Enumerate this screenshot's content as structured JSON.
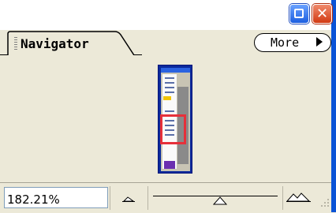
{
  "window": {
    "buttons": {
      "minimize": "minimize-icon",
      "close": "close-icon"
    }
  },
  "tab": {
    "label": "Navigator"
  },
  "more_button": {
    "label": "More"
  },
  "zoom": {
    "value": "182.21%"
  },
  "colors": {
    "panel_bg": "#ece9d8",
    "view_box": "#e6303a",
    "thumbnail_bg": "#0a2a9c",
    "close": "#d23a12",
    "minimize": "#1c5fe0"
  }
}
